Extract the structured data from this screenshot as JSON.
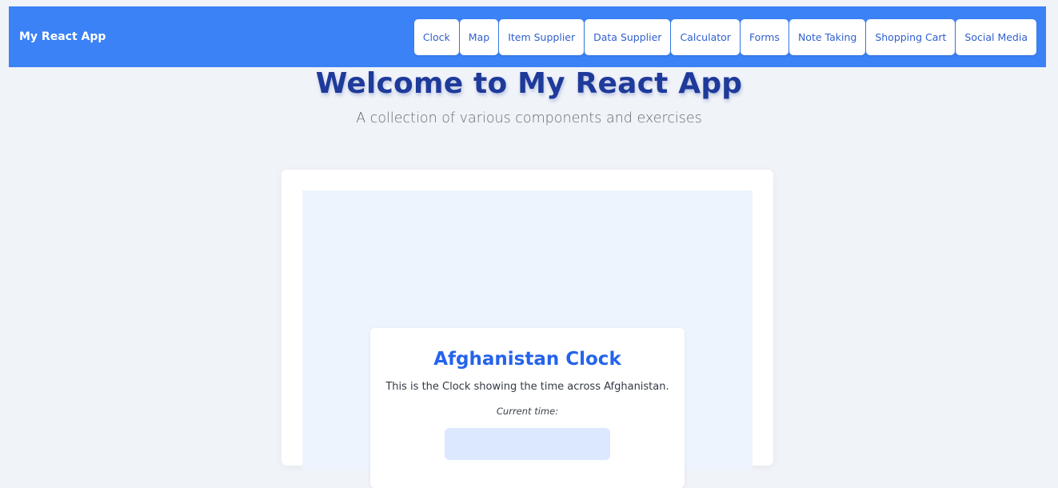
{
  "navbar": {
    "brand": "My React App",
    "links": [
      {
        "label": "Clock"
      },
      {
        "label": "Map"
      },
      {
        "label": "Item Supplier"
      },
      {
        "label": "Data Supplier"
      },
      {
        "label": "Calculator"
      },
      {
        "label": "Forms"
      },
      {
        "label": "Note Taking"
      },
      {
        "label": "Shopping Cart"
      },
      {
        "label": "Social Media"
      }
    ]
  },
  "hero": {
    "title": "Welcome to My React App",
    "subtitle": "A collection of various components and exercises"
  },
  "clock": {
    "title": "Afghanistan Clock",
    "description": "This is the Clock showing the time across Afghanistan.",
    "current_time_label": "Current time:"
  },
  "colors": {
    "navbar_bg": "#3b82f6",
    "page_bg": "#f0f3f8",
    "accent": "#2563eb",
    "hero_title": "#1e3a9a"
  }
}
